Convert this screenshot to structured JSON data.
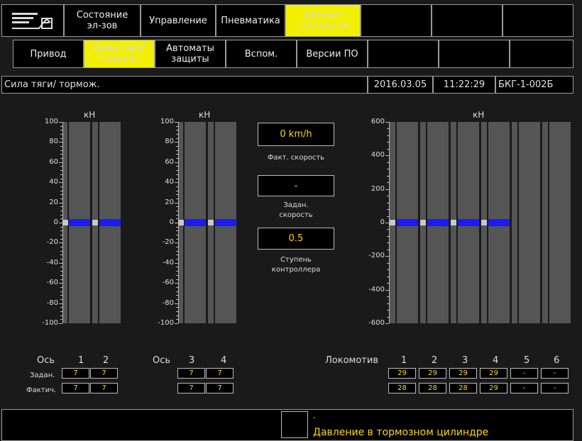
{
  "top_tabs": [
    "Состояние\nэл-зов",
    "Управление",
    "Пневматика",
    "Данные\nсостояния",
    "",
    "",
    "",
    ""
  ],
  "sub_tabs": [
    "Привод",
    "Сила тяги/\nтормож.",
    "Автоматы\nзащиты",
    "Вспом.",
    "Версии ПО",
    "",
    "",
    ""
  ],
  "header": {
    "title": "Сила тяги/ тормож.",
    "date": "2016.03.05",
    "time": "11:22:29",
    "id": "БКГ-1-002Б"
  },
  "unit": "кН",
  "scale_left": {
    "min": -100,
    "max": 100,
    "labels": [
      "100",
      "80",
      "60",
      "40",
      "20",
      "0",
      "-20",
      "-40",
      "-60",
      "-80",
      "-100"
    ]
  },
  "scale_right": {
    "min": -600,
    "max": 600,
    "labels": [
      "600",
      "400",
      "200",
      "0",
      "-200",
      "-400",
      "-600"
    ]
  },
  "axis_label": "Ось",
  "loco_label": "Локомотив",
  "axes_group1": [
    "1",
    "2"
  ],
  "axes_group2": [
    "3",
    "4"
  ],
  "locos": [
    "1",
    "2",
    "3",
    "4",
    "5",
    "6"
  ],
  "row_labels": {
    "set": "Задан.",
    "actual": "Фактич."
  },
  "group1_set": [
    "7",
    "7"
  ],
  "group1_actual": [
    "7",
    "7"
  ],
  "group2_set": [
    "7",
    "7"
  ],
  "group2_actual": [
    "7",
    "7"
  ],
  "loco_set": [
    "29",
    "29",
    "29",
    "29",
    "-",
    "-"
  ],
  "loco_actual": [
    "28",
    "28",
    "28",
    "29",
    "-",
    "-"
  ],
  "speed": {
    "actual_value": "0 km/h",
    "actual_label": "Факт. скорость",
    "set_value": "-",
    "set_label": "Задан.\nскорость",
    "step_value": "0.5",
    "step_label": "Ступень\nконтроллера"
  },
  "status": {
    "line1": "-",
    "line2": "Давление в тормозном цилиндре"
  },
  "colors": {
    "selected": "#f2f000",
    "bar": "#555555",
    "level": "#1a1aff",
    "value": "#ffd800"
  }
}
